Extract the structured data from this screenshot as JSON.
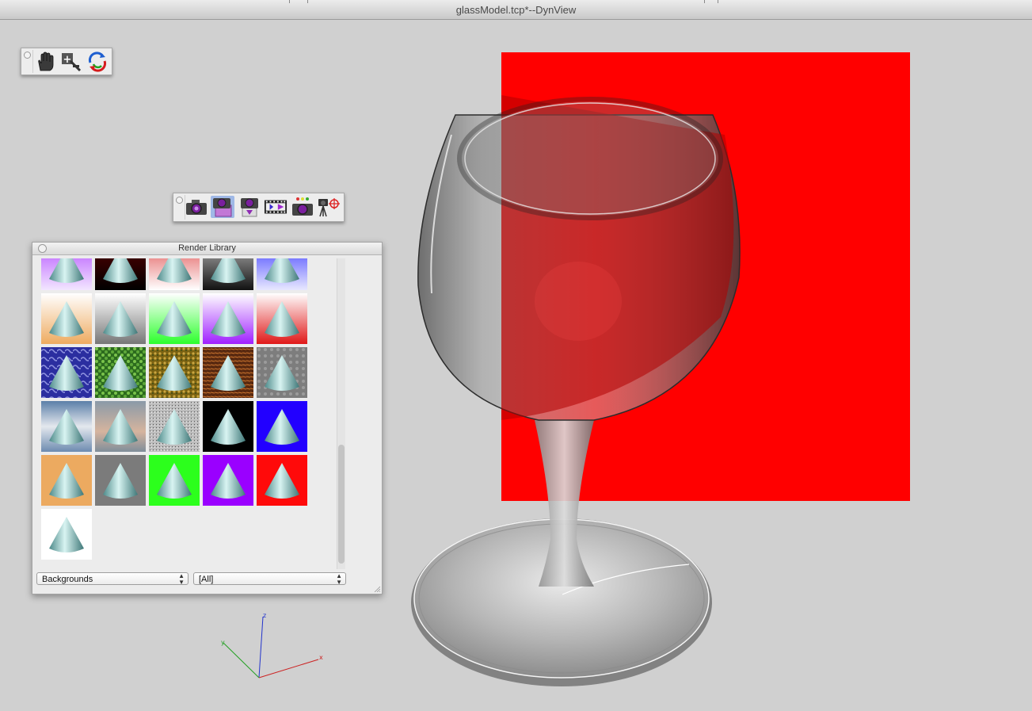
{
  "window": {
    "title": "glassModel.tcp*--DynView"
  },
  "nav_toolbar": {
    "tools": [
      {
        "name": "pan-hand-icon",
        "tooltip": ""
      },
      {
        "name": "zoom-icon",
        "tooltip": ""
      },
      {
        "name": "rotate-icon",
        "tooltip": ""
      }
    ]
  },
  "render_toolbar": {
    "active_index": 1,
    "tools": [
      {
        "name": "render-camera-icon"
      },
      {
        "name": "render-library-icon"
      },
      {
        "name": "render-settings-icon"
      },
      {
        "name": "render-animation-icon"
      },
      {
        "name": "render-camera-options-icon"
      },
      {
        "name": "camera-target-icon"
      }
    ]
  },
  "render_library": {
    "title": "Render Library",
    "category_select": {
      "value": "Backgrounds"
    },
    "filter_select": {
      "value": "[All]"
    },
    "thumbnails": [
      [
        "purple-gradient",
        "dark-red-gradient",
        "red-white-gradient",
        "gray-black-gradient",
        "blue-gradient"
      ],
      [
        "peach-gradient",
        "gray-white-gradient",
        "green-gradient",
        "purple-white-gradient",
        "red-gradient"
      ],
      [
        "blue-marble",
        "green-leaves",
        "gold-texture",
        "brown-texture",
        "gray-stone"
      ],
      [
        "sky-clouds",
        "sunset-sky",
        "granite-texture",
        "solid-black",
        "solid-blue"
      ],
      [
        "solid-peach",
        "solid-gray",
        "solid-green",
        "solid-purple",
        "solid-red"
      ],
      [
        "solid-white"
      ]
    ]
  },
  "axes": {
    "x": "x",
    "y": "y",
    "z": "z"
  },
  "colors": {
    "background_plane": "#ff0000",
    "viewport": "#d0d0d0",
    "axis_x": "#cc0000",
    "axis_y": "#00a000",
    "axis_z": "#0000cc"
  }
}
